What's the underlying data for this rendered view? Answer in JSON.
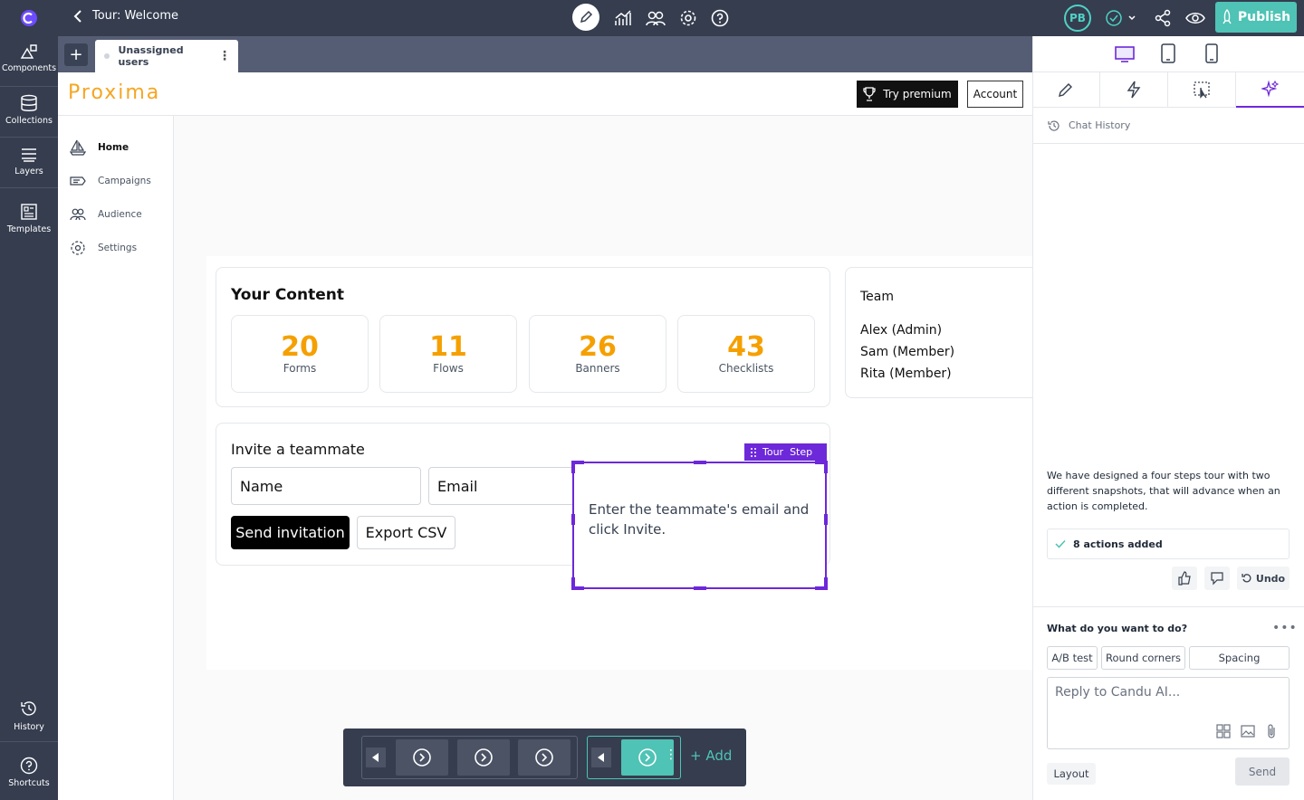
{
  "topbar": {
    "title": "Tour: Welcome",
    "avatar_initials": "PB",
    "publish_label": "Publish",
    "icons": [
      "edit-icon",
      "analytics-icon",
      "audience-icon",
      "settings-icon",
      "help-icon",
      "status-check-icon",
      "share-icon",
      "preview-icon",
      "rocket-icon"
    ]
  },
  "rail": {
    "items": [
      {
        "label": "Components",
        "icon": "components-icon"
      },
      {
        "label": "Collections",
        "icon": "collections-icon"
      },
      {
        "label": "Layers",
        "icon": "layers-icon"
      },
      {
        "label": "Templates",
        "icon": "templates-icon"
      },
      {
        "label": "History",
        "icon": "history-icon"
      },
      {
        "label": "Shortcuts",
        "icon": "shortcuts-icon"
      }
    ]
  },
  "tabs": {
    "add": "+",
    "active": "Unassigned users"
  },
  "app": {
    "brand": "Proxima",
    "premium_label": "Try premium",
    "account_label": "Account",
    "nav": [
      {
        "label": "Home",
        "icon": "sailboat-icon"
      },
      {
        "label": "Campaigns",
        "icon": "campaigns-icon"
      },
      {
        "label": "Audience",
        "icon": "audience-icon"
      },
      {
        "label": "Settings",
        "icon": "settings-icon"
      }
    ],
    "content_title": "Your Content",
    "stats": [
      {
        "value": "20",
        "label": "Forms"
      },
      {
        "value": "11",
        "label": "Flows"
      },
      {
        "value": "26",
        "label": "Banners"
      },
      {
        "value": "43",
        "label": "Checklists"
      }
    ],
    "team_title": "Team",
    "team": [
      "Alex (Admin)",
      "Sam (Member)",
      "Rita (Member)"
    ],
    "invite_title": "Invite a teammate",
    "name_placeholder": "Name",
    "email_placeholder": "Email",
    "send_label": "Send invitation",
    "export_label": "Export CSV"
  },
  "tour_step": {
    "tag": "Tour  Step",
    "text": "Enter the teammate's email and click Invite."
  },
  "steps_bar": {
    "add_label": "+ Add",
    "accent": "#4fc3b5"
  },
  "panel": {
    "chat_history_label": "Chat History",
    "message": "We have designed a four steps tour with two different snapshots, that will advance when an action is completed.",
    "actions_added": "8 actions added",
    "undo_label": "Undo",
    "prompt_title": "What do you want to do?",
    "chips": [
      "A/B test",
      "Round corners",
      "Spacing"
    ],
    "reply_placeholder": "Reply to Candu AI...",
    "layout_label": "Layout",
    "send_label": "Send",
    "accent": "#6d28d9"
  }
}
